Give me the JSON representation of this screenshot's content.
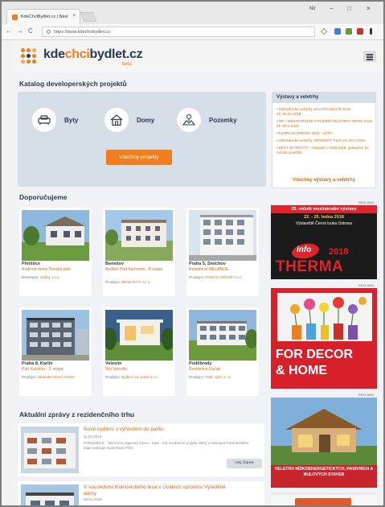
{
  "browser": {
    "tab_title": "KdeChciBydlet.cz | Navi",
    "tab_close": "×",
    "user": "Nir",
    "win_min": "–",
    "win_max": "□",
    "win_close": "×",
    "back": "←",
    "forward": "→",
    "reload": "C",
    "url": "https://www.kdechcibydlet.cz"
  },
  "site": {
    "logo_part1": "kde",
    "logo_part2": "chci",
    "logo_part3": "bydlet",
    "logo_tld": ".cz",
    "logo_beta": "beta"
  },
  "catalog": {
    "heading": "Katalog developerských projektů",
    "items": [
      {
        "label": "Byty",
        "icon": "couch-icon"
      },
      {
        "label": "Domy",
        "icon": "house-icon"
      },
      {
        "label": "Pozemky",
        "icon": "landscape-icon"
      }
    ],
    "button": "Všechny projekty"
  },
  "expo": {
    "heading": "Výstavy a veletrhy",
    "items": [
      "• Zahradnické veletrhy, art KARLSRUHE 2018, 22.-25.02.2018",
      "• IBF - MEZINÁRODNÍ STAVEBNÍ VELETRHY BRNO 2018, 25.-28.4.2018",
      "• FLORA OLOMOUC 2018 - LÉTO",
      "• Zahradnické veletrhy, INTERMAT Paris 23.-28.4.2018",
      "• BEST OF REALTY - Nejlepší z realit 2018, galavečer 25. ročníku soutěže"
    ],
    "link": "Všechny výstavy a veletrhy"
  },
  "recommended": {
    "heading": "Doporučujeme",
    "cards": [
      {
        "city": "Přelštice",
        "title": "Rodinné domy Panská pole",
        "dev_label": "Developer:",
        "dev": "ctobiq, s.r.o."
      },
      {
        "city": "Benešov",
        "title": "Bydlení Pod Karlovem - B etapa",
        "dev_label": "Prodejce:",
        "dev": "BENE BYTY s.r.o."
      },
      {
        "city": "Praha 5, Smíchov",
        "title": "Rezidence MÉLANGE",
        "dev_label": "Prodejce:",
        "dev": "FINECO GROUP s.r.o."
      },
      {
        "city": "Praha 8, Karlín",
        "title": "Port Karolina - 2. etapa",
        "dev_label": "Prodejce:",
        "dev": "Skanska Home Center"
      },
      {
        "city": "Veleslín",
        "title": "Vily Veleslín",
        "dev_label": "Prodejce:",
        "dev": "Bydlení za Veselí s.r.o."
      },
      {
        "city": "Poděbrady",
        "title": "Rezidence Dučák",
        "dev_label": "Prodejce:",
        "dev": "FMS, spol. s r.o."
      }
    ]
  },
  "news": {
    "heading": "Aktuální zprávy z rezidenčního trhu",
    "items": [
      {
        "title": "Nové bydlení s výhledem do parku",
        "date": "11.01.2018",
        "text": "PARDUBICE - Tak trochu tajemný název - Safe - má rezidenční projekt, který v metropoli Pardubického kraje realizuje společnost PSN.",
        "more": "celý článek"
      },
      {
        "title": "V sousedství Klánovického lesa v Úvalech vyrostou Vyladěné domy",
        "date": "09.01.2018"
      }
    ]
  },
  "ads": {
    "label": "REKLAMA",
    "therma_line1": "25. ročník mezinárodní výstavy",
    "therma_line2": "22. - 25. ledna 2018",
    "therma_line3": "Výstaviště Černá louka Ostrava",
    "therma_info": "info",
    "therma_year": "2018",
    "therma_name": "THERMA",
    "decor_line1": "FOR DECOR",
    "decor_line2": "& HOME",
    "house_text": "VELETRH NÍZKOENERGETICKÝCH, PASIVNÍCH A NULOVÝCH STAVEB"
  },
  "colors": {
    "accent": "#f07e1e",
    "navy": "#2a3a4c",
    "panel": "#d5dde6",
    "ad_red": "#d8202a"
  }
}
